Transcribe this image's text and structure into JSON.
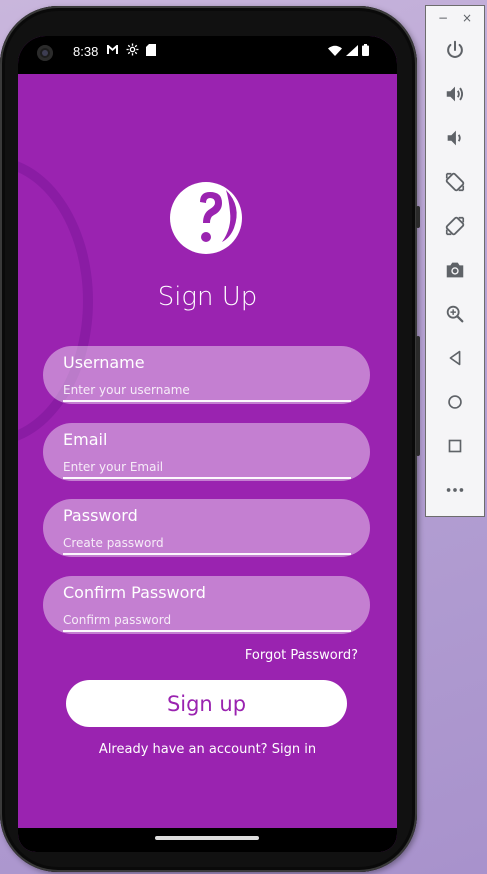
{
  "status_bar": {
    "time": "8:38",
    "left_icons": [
      "gmail-icon",
      "settings-icon",
      "sd-card-icon"
    ],
    "right_icons": [
      "wifi-icon",
      "signal-icon",
      "battery-icon"
    ]
  },
  "screen": {
    "title": "Sign Up",
    "fields": [
      {
        "label": "Username",
        "placeholder": "Enter your username"
      },
      {
        "label": "Email",
        "placeholder": "Enter your Email"
      },
      {
        "label": "Password",
        "placeholder": "Create password"
      },
      {
        "label": "Confirm Password",
        "placeholder": "Confirm password"
      }
    ],
    "forgot_password": "Forgot Password?",
    "signup_button": "Sign up",
    "signin_prompt": "Already have an account? Sign in"
  },
  "toolbar": {
    "window_controls": {
      "minimize": "−",
      "close": "×"
    },
    "tools": [
      "power-icon",
      "volume-up-icon",
      "volume-down-icon",
      "rotate-left-icon",
      "rotate-right-icon",
      "screenshot-icon",
      "zoom-icon",
      "back-icon",
      "home-icon",
      "overview-icon",
      "more-icon"
    ]
  },
  "colors": {
    "accent": "#9a23b0",
    "field_bg": "rgba(255,255,255,0.42)",
    "text": "#ffffff"
  }
}
